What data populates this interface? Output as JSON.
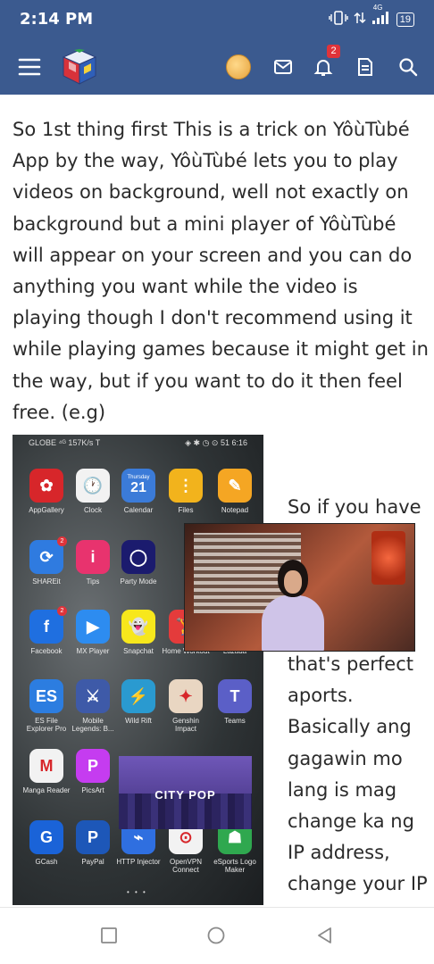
{
  "status_bar": {
    "time": "2:14 PM",
    "network": "4G",
    "battery": "19"
  },
  "app_bar": {
    "notifications_count": "2",
    "colors": {
      "background": "#3b5a8f",
      "badge": "#e0333a"
    }
  },
  "article": {
    "paragraph1": "So 1st thing first This is a trick on YôùTùbé App by the way, YôùTùbé lets you to play videos on background, well not exactly on background but a mini player of YôùTùbé will appear on your screen and you can do anything you want while the video is playing though I don't recommend using it while playing games because it might get in the way, but if you want to do it then feel free. (e.g)",
    "paragraph2": "So if you have",
    "paragraph3": "that's perfect aports. Basically ang gagawin mo lang is mag change ka ng IP address, change your IP"
  },
  "embedded_screenshot": {
    "status_left": "GLOBE ⁴ᴳ  157K/s  T",
    "status_right": "◈ ✱ ◷ ⊙ 51 6:16",
    "calendar_day": "Thursday",
    "calendar_date": "21",
    "apps": [
      {
        "label": "AppGallery",
        "glyph": "✿",
        "color": "#d7262a"
      },
      {
        "label": "Clock",
        "glyph": "🕐",
        "color": "#f2f2f2"
      },
      {
        "label": "Calendar",
        "glyph": "",
        "color": "#3b7bd8"
      },
      {
        "label": "Files",
        "glyph": "⋮",
        "color": "#f2b31c"
      },
      {
        "label": "Notepad",
        "glyph": "✎",
        "color": "#f5a623"
      },
      {
        "label": "SHAREit",
        "glyph": "⟳",
        "color": "#2f7be0"
      },
      {
        "label": "Tips",
        "glyph": "i",
        "color": "#e8336e"
      },
      {
        "label": "Party Mode",
        "glyph": "◯",
        "color": "#1b1b6e"
      },
      {
        "label": "Facebook",
        "glyph": "f",
        "color": "#1f6fe0"
      },
      {
        "label": "MX Player",
        "glyph": "▶",
        "color": "#2d8cf0"
      },
      {
        "label": "Snapchat",
        "glyph": "👻",
        "color": "#f7e71c"
      },
      {
        "label": "Home Workout",
        "glyph": "🏋",
        "color": "#e43b3b"
      },
      {
        "label": "Lazada",
        "glyph": "♥",
        "color": "#f04a2a"
      },
      {
        "label": "ES File Explorer Pro",
        "glyph": "ES",
        "color": "#2c7de0"
      },
      {
        "label": "Mobile Legends: B...",
        "glyph": "⚔",
        "color": "#3e5aa8"
      },
      {
        "label": "Wild Rift",
        "glyph": "⚡",
        "color": "#2a9ad0"
      },
      {
        "label": "Genshin Impact",
        "glyph": "✦",
        "color": "#e9d6c2"
      },
      {
        "label": "Teams",
        "glyph": "T",
        "color": "#5b5fc7"
      },
      {
        "label": "Manga Reader",
        "glyph": "M",
        "color": "#f2f2f2"
      },
      {
        "label": "PicsArt",
        "glyph": "P",
        "color": "#c53cf0"
      },
      {
        "label": "GCash",
        "glyph": "G",
        "color": "#1a63d8"
      },
      {
        "label": "PayPal",
        "glyph": "P",
        "color": "#1d57b8"
      },
      {
        "label": "HTTP Injector",
        "glyph": "⌁",
        "color": "#2f6fe0"
      },
      {
        "label": "OpenVPN Connect",
        "glyph": "⊙",
        "color": "#f2f2f2"
      },
      {
        "label": "eSports Logo Maker",
        "glyph": "☗",
        "color": "#2fa84f"
      }
    ],
    "mini_player_label": "CITY POP",
    "badges": [
      "2",
      "2"
    ]
  },
  "nav_bar": {
    "recents": "recents-square-icon",
    "home": "home-circle-icon",
    "back": "back-triangle-icon"
  }
}
